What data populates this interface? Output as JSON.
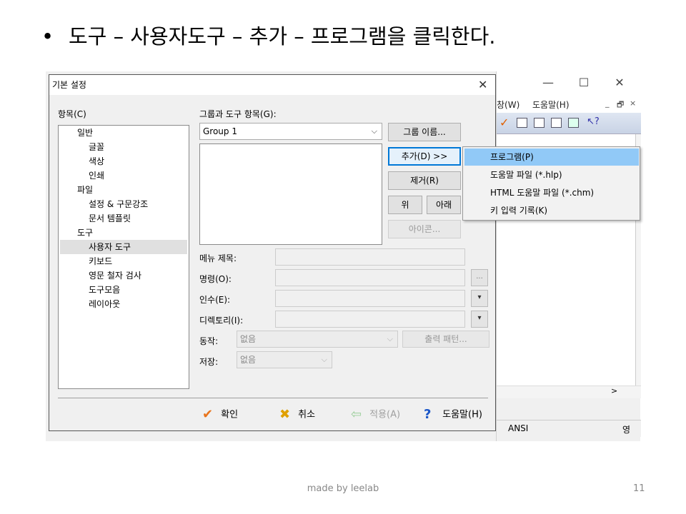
{
  "slide": {
    "bullet": "•",
    "title": "도구 – 사용자도구 – 추가 – 프로그램을 클릭한다.",
    "footer": "made by leelab",
    "page_number": "11"
  },
  "background_window": {
    "controls": {
      "minimize": "—",
      "maximize": "☐",
      "close": "✕"
    },
    "menu": [
      "창(W)",
      "도움말(H)"
    ],
    "mdi_controls": [
      "_",
      "🗗",
      "×"
    ],
    "status": {
      "encoding": "ANSI",
      "lang": "영"
    }
  },
  "dialog": {
    "title": "기본 설정",
    "close": "✕",
    "categories_label": "항목(C)",
    "tree": [
      "일반",
      "글꼴",
      "색상",
      "인쇄",
      "파일",
      "설정 & 구문강조",
      "문서 템플릿",
      "도구",
      "사용자 도구",
      "키보드",
      "영문 철자 검사",
      "도구모음",
      "레이아웃"
    ],
    "group_label": "그룹과 도구 항목(G):",
    "group_value": "Group 1",
    "buttons": {
      "rename_group": "그룹 이름...",
      "add": "추가(D) >>",
      "remove": "제거(R)",
      "up": "위",
      "down": "아래",
      "icon": "아이콘..."
    },
    "fields": {
      "menu_title": "메뉴 제목:",
      "command": "명령(O):",
      "argument": "인수(E):",
      "directory": "디렉토리(I):",
      "action": "동작:",
      "action_value": "없음",
      "output_pattern": "출력 패턴...",
      "save": "저장:",
      "save_value": "없음",
      "ellipsis": "..."
    },
    "footer": {
      "ok": "확인",
      "cancel": "취소",
      "apply": "적용(A)",
      "help": "도움말(H)"
    }
  },
  "add_menu": {
    "items": [
      "프로그램(P)",
      "도움말 파일 (*.hlp)",
      "HTML 도움말 파일 (*.chm)",
      "키 입력 기록(K)"
    ],
    "selected": "프로그램(P)"
  }
}
